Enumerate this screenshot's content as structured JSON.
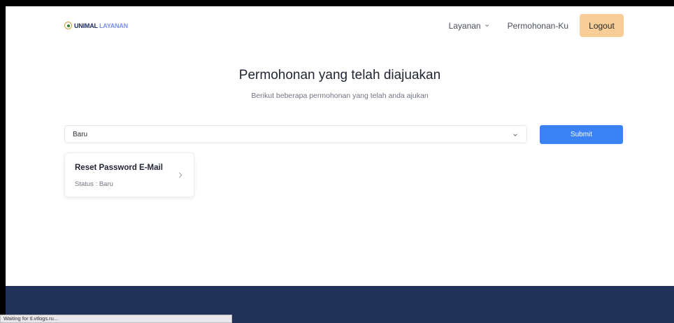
{
  "header": {
    "logo": {
      "part_a": "UNIMAL",
      "part_b": "LAYANAN"
    },
    "nav": {
      "layanan_label": "Layanan",
      "permohonan_label": "Permohonan-Ku",
      "logout_label": "Logout"
    }
  },
  "main": {
    "title": "Permohonan yang telah diajuakan",
    "subtitle": "Berikut beberapa permohonan yang telah anda ajukan",
    "filter": {
      "selected": "Baru",
      "submit_label": "Submit"
    },
    "requests": [
      {
        "title": "Reset Password E-Mail",
        "status": "Status : Baru"
      }
    ]
  },
  "browser": {
    "status_text": "Waiting for tl.vtlogs.ru..."
  },
  "colors": {
    "accent": "#3b82f6",
    "logout_bg": "#f8cd98",
    "footer_bg": "#223158"
  },
  "icons": {
    "dropdown": "chevron-down-icon",
    "card_arrow": "chevron-right-icon"
  }
}
